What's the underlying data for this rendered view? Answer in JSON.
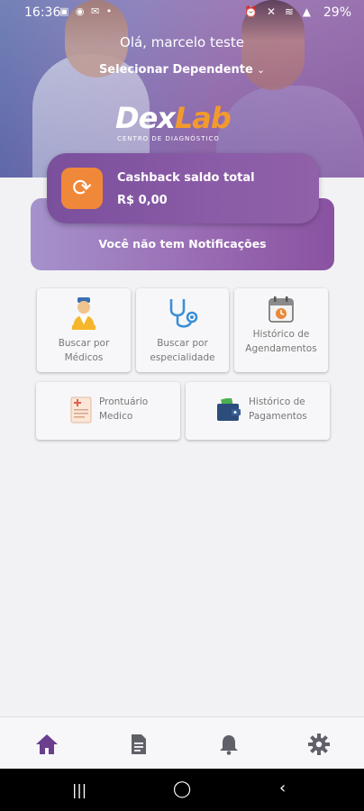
{
  "status_bar": {
    "time": "16:36",
    "left_icons": [
      "image-icon",
      "whatsapp-icon",
      "email-icon",
      "dot-icon"
    ],
    "right_icons": [
      "alarm-icon",
      "mute-icon",
      "wifi-icon",
      "signal-icon"
    ],
    "battery": "29%"
  },
  "header": {
    "greeting": "Olá, marcelo teste",
    "dependent_selector": "Selecionar Dependente",
    "logo": {
      "part1": "Dex",
      "part2": "Lab",
      "tagline": "CENTRO DE DIAGNÓSTICO"
    }
  },
  "cashback": {
    "label": "Cashback saldo total",
    "value": "R$ 0,00",
    "icon": "refresh-icon",
    "icon_color": "#f0883a"
  },
  "notifications": {
    "message": "Você não tem Notificações"
  },
  "menu": [
    {
      "label_lines": [
        "Buscar por",
        "Médicos"
      ],
      "icon": "doctor-icon"
    },
    {
      "label_lines": [
        "Buscar por",
        "especialidade"
      ],
      "icon": "stethoscope-icon"
    },
    {
      "label_lines": [
        "Histórico de",
        "Agendamentos"
      ],
      "icon": "calendar-icon"
    },
    {
      "label_lines": [
        "Prontuário",
        "Medico"
      ],
      "icon": "medical-record-icon"
    },
    {
      "label_lines": [
        "Histórico de",
        "Pagamentos"
      ],
      "icon": "wallet-icon"
    }
  ],
  "bottom_nav": [
    {
      "name": "home",
      "icon": "home-icon",
      "active": true
    },
    {
      "name": "documents",
      "icon": "document-icon",
      "active": false
    },
    {
      "name": "notifications",
      "icon": "bell-icon",
      "active": false
    },
    {
      "name": "settings",
      "icon": "gear-icon",
      "active": false
    }
  ],
  "colors": {
    "brand_purple": "#7a4f9c",
    "accent_orange": "#f0883a",
    "nav_active": "#6a3f8e",
    "nav_inactive": "#606068"
  }
}
